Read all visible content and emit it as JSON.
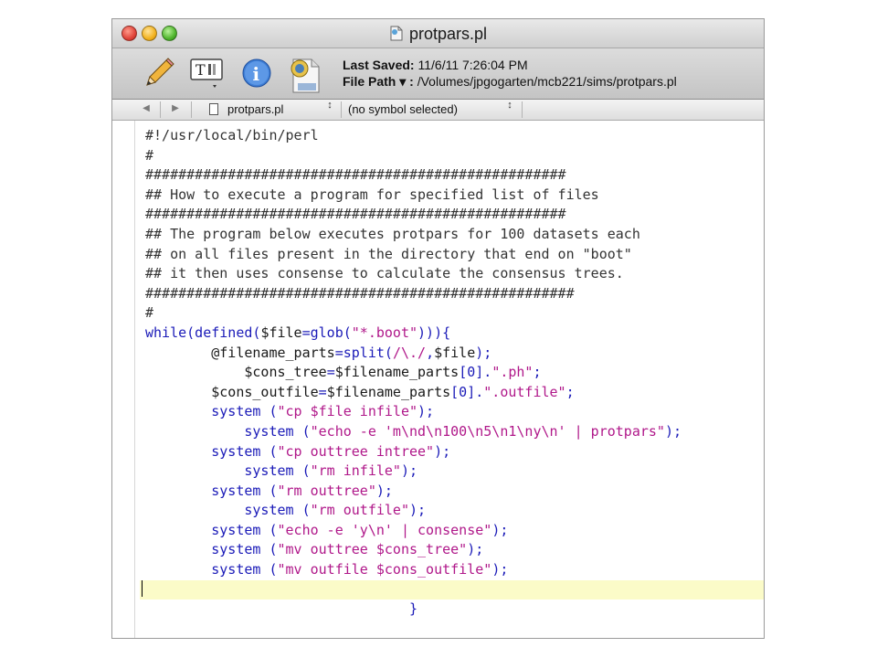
{
  "window": {
    "title": "protpars.pl"
  },
  "toolbar": {
    "last_saved_label": "Last Saved:",
    "last_saved_value": "11/6/11 7:26:04 PM",
    "file_path_label": "File Path ▾ :",
    "file_path_value": "/Volumes/jpgogarten/mcb221/sims/protpars.pl",
    "textfile_badge": "TEXT"
  },
  "navbar": {
    "file_menu": "protpars.pl",
    "symbol_menu": "(no symbol selected)",
    "updown": "↕"
  },
  "code": {
    "lines": [
      "#!/usr/local/bin/perl",
      "#",
      "###################################################",
      "## How to execute a program for specified list of files",
      "###################################################",
      "## The program below executes protpars for 100 datasets each",
      "## on all files present in the directory that end on \"boot\"",
      "## it then uses consense to calculate the consensus trees.",
      "####################################################",
      "#",
      "while(defined($file=glob(\"*.boot\"))){",
      "        @filename_parts=split(/\\./,$file);",
      "            $cons_tree=$filename_parts[0].\".ph\";",
      "        $cons_outfile=$filename_parts[0].\".outfile\";",
      "        system (\"cp $file infile\");",
      "            system (\"echo -e 'm\\nd\\n100\\n5\\n1\\ny\\n' | protpars\");",
      "        system (\"cp outtree intree\");",
      "            system (\"rm infile\");",
      "        system (\"rm outtree\");",
      "            system (\"rm outfile\");",
      "        system (\"echo -e 'y\\n' | consense\");",
      "        system (\"mv outtree $cons_tree\");",
      "        system (\"mv outfile $cons_outfile\");",
      "",
      "                                }"
    ],
    "current_line_index": 23
  },
  "colors": {
    "keyword": "#1b1bb8",
    "string": "#b0188a",
    "comment": "#333333",
    "current_line_highlight": "#fbfbc8"
  },
  "icons": [
    "pencil-icon",
    "text-format-icon",
    "info-icon",
    "text-file-icon",
    "back-arrow-icon",
    "forward-arrow-icon",
    "document-icon"
  ]
}
